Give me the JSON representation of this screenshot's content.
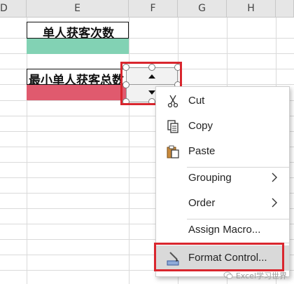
{
  "columns": [
    "D",
    "E",
    "F",
    "G",
    "H"
  ],
  "cells": {
    "e2": "单人获客次数",
    "e5": "最小单人获客总数"
  },
  "colors": {
    "green_fill": "#82d2b4",
    "red_fill": "#e05a6e",
    "highlight_red": "#d9262e",
    "menu_hover": "#d9d9d9"
  },
  "context_menu": {
    "items": [
      {
        "label": "Cut",
        "icon": "scissors-icon"
      },
      {
        "label": "Copy",
        "icon": "copy-icon"
      },
      {
        "label": "Paste",
        "icon": "paste-icon"
      },
      {
        "label": "Grouping",
        "submenu": true
      },
      {
        "label": "Order",
        "submenu": true
      },
      {
        "label": "Assign Macro..."
      },
      {
        "label": "Format Control...",
        "icon": "format-control-icon",
        "highlighted": true
      }
    ]
  },
  "watermark": "Excel学习世界"
}
